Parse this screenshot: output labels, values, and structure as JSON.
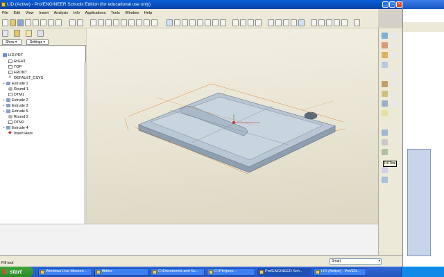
{
  "window": {
    "title": "LID (Active) - Pro/ENGINEER Schools Edition (for educational use only)",
    "controls": [
      "minimize",
      "maximize",
      "close"
    ]
  },
  "menu": [
    "File",
    "Edit",
    "View",
    "Insert",
    "Analysis",
    "Info",
    "Applications",
    "Tools",
    "Window",
    "Help"
  ],
  "panel": {
    "tabs": [
      "Show",
      "Settings"
    ],
    "tree": [
      {
        "label": "LID.PRT",
        "icon": "part-icon"
      },
      {
        "label": "RIGHT",
        "icon": "datum-plane-icon"
      },
      {
        "label": "TOP",
        "icon": "datum-plane-icon"
      },
      {
        "label": "FRONT",
        "icon": "datum-plane-icon"
      },
      {
        "label": "DEFAULT_CSYS",
        "icon": "csys-icon"
      },
      {
        "label": "Extrude 1",
        "icon": "extrude-icon"
      },
      {
        "label": "Round 1",
        "icon": "round-icon"
      },
      {
        "label": "DTM1",
        "icon": "datum-plane-icon"
      },
      {
        "label": "Extrude 2",
        "icon": "extrude-icon"
      },
      {
        "label": "Extrude 3",
        "icon": "extrude-icon"
      },
      {
        "label": "Extrude 5",
        "icon": "extrude-icon"
      },
      {
        "label": "Round 2",
        "icon": "round-icon"
      },
      {
        "label": "DTM2",
        "icon": "datum-plane-icon"
      },
      {
        "label": "Extrude 4",
        "icon": "extrude-icon"
      },
      {
        "label": "Insert Here",
        "icon": "insert-here-icon"
      }
    ]
  },
  "status": {
    "label": "Fill tool",
    "filter": "Smart"
  },
  "tooltip": "Fill Tool",
  "taskbar": {
    "start": "start",
    "tasks": [
      "Windows Live Messen...",
      "ffbbbs",
      "C:\\Documents and Se...",
      "C:\\Ptc\\proe...",
      "Pro/ENGINEER Sch...",
      "LID (Active) - Pro/EN..."
    ]
  },
  "colors": {
    "model": "#b9c7d4",
    "titlebar": "#0a5fd8",
    "viewport": "#e6e1cf",
    "taskbar": "#2456c0"
  }
}
